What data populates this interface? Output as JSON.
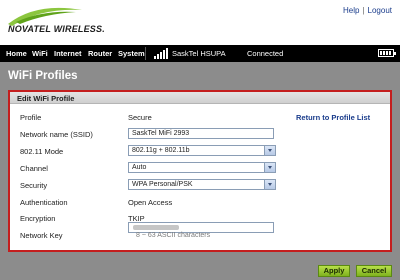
{
  "header": {
    "brand": "NOVATEL WIRELESS.",
    "links": {
      "help": "Help",
      "separator": "|",
      "logout": "Logout"
    }
  },
  "nav": {
    "items": [
      "Home",
      "WiFi",
      "Internet",
      "Router",
      "System"
    ],
    "carrier": "SaskTel HSUPA",
    "connection_status": "Connected"
  },
  "page": {
    "title": "WiFi Profiles"
  },
  "panel": {
    "heading": "Edit WiFi Profile",
    "return_link": "Return to Profile List",
    "rows": {
      "profile": {
        "label": "Profile",
        "value": "Secure"
      },
      "ssid": {
        "label": "Network name (SSID)",
        "value": "SaskTel MiFi 2993"
      },
      "mode": {
        "label": "802.11 Mode",
        "value": "802.11g + 802.11b"
      },
      "channel": {
        "label": "Channel",
        "value": "Auto"
      },
      "security": {
        "label": "Security",
        "value": "WPA Personal/PSK"
      },
      "authentication": {
        "label": "Authentication",
        "value": "Open Access"
      },
      "encryption": {
        "label": "Encryption",
        "value": "TKIP"
      },
      "network_key": {
        "label": "Network Key",
        "hint": "8 ~ 63 ASCII characters"
      }
    }
  },
  "buttons": {
    "apply": "Apply",
    "cancel": "Cancel"
  },
  "colors": {
    "accent_red": "#c41e1e",
    "brand_green": "#7fb21e",
    "link_blue": "#1b3d8c"
  }
}
